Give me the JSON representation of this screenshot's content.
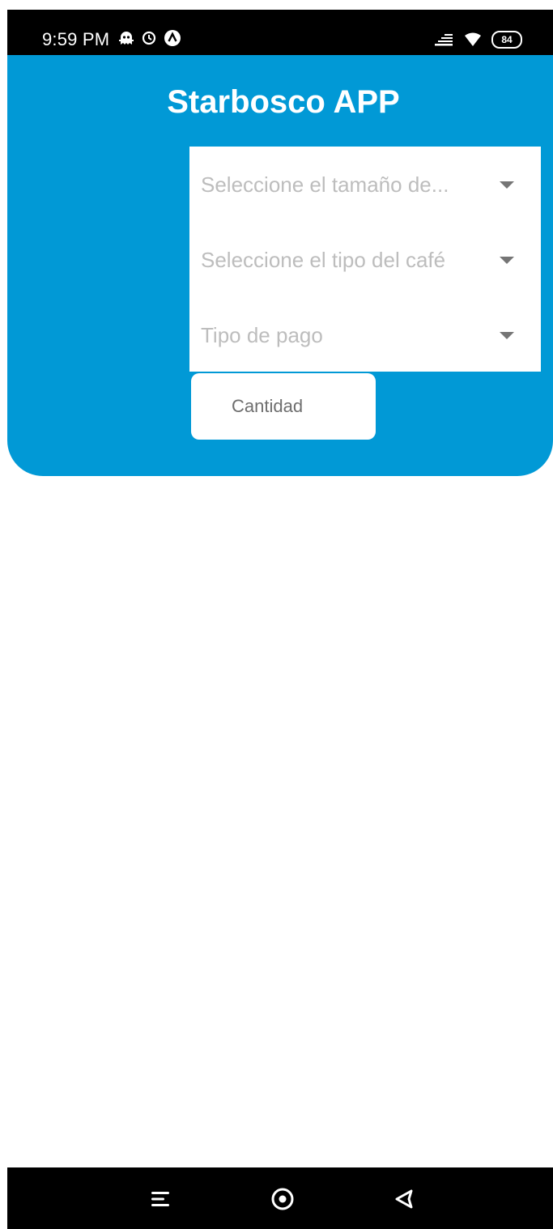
{
  "status_bar": {
    "time": "9:59 PM",
    "battery": "84",
    "icons_left": [
      "ghost-icon",
      "alarm-icon",
      "arrow-up-circle-icon"
    ],
    "icons_right": [
      "data-signal-icon",
      "wifi-icon",
      "battery-icon"
    ]
  },
  "header": {
    "title": "Starbosco APP",
    "color": "#0199d6"
  },
  "form": {
    "size_placeholder": "Seleccione el tamaño de...",
    "coffee_type_placeholder": "Seleccione el tipo del café",
    "payment_placeholder": "Tipo de pago",
    "quantity_placeholder": "Cantidad"
  },
  "nav_bar": {
    "icons": [
      "menu-icon",
      "home-icon",
      "back-icon"
    ]
  }
}
